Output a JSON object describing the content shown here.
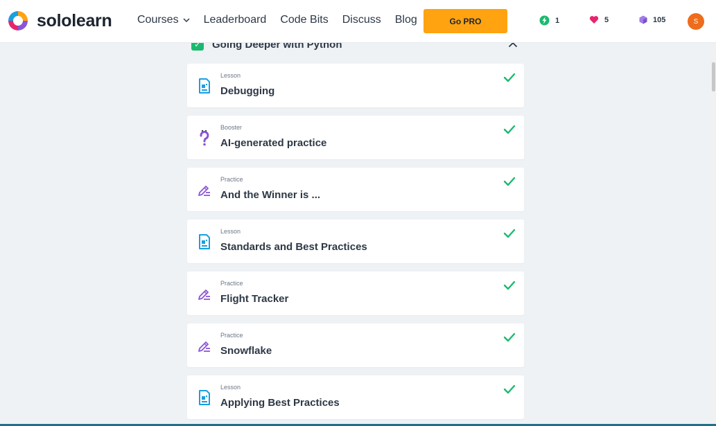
{
  "brand": {
    "name": "sololearn"
  },
  "nav": {
    "items": [
      {
        "label": "Courses",
        "has_dropdown": true
      },
      {
        "label": "Leaderboard"
      },
      {
        "label": "Code Bits"
      },
      {
        "label": "Discuss"
      },
      {
        "label": "Blog"
      }
    ],
    "go_pro_label": "Go PRO"
  },
  "stats": {
    "streak": "1",
    "hearts": "5",
    "bits": "105"
  },
  "user": {
    "avatar_initial": "S"
  },
  "module": {
    "title": "Going Deeper with Python",
    "completed": true
  },
  "lessons": [
    {
      "type": "Lesson",
      "title": "Debugging",
      "icon": "lesson-doc-icon",
      "done": true
    },
    {
      "type": "Booster",
      "title": "AI-generated practice",
      "icon": "question-icon",
      "done": true
    },
    {
      "type": "Practice",
      "title": "And the Winner is ...",
      "icon": "pencil-icon",
      "done": true
    },
    {
      "type": "Lesson",
      "title": "Standards and Best Practices",
      "icon": "lesson-doc-icon",
      "done": true
    },
    {
      "type": "Practice",
      "title": "Flight Tracker",
      "icon": "pencil-icon",
      "done": true
    },
    {
      "type": "Practice",
      "title": "Snowflake",
      "icon": "pencil-icon",
      "done": true
    },
    {
      "type": "Lesson",
      "title": "Applying Best Practices",
      "icon": "lesson-doc-icon",
      "done": true
    }
  ],
  "colors": {
    "accent_orange": "#ffa310",
    "check_green": "#1bb96f",
    "lesson_blue": "#1a9fe0",
    "practice_purple": "#8a55d6",
    "heart_pink": "#e8246d"
  }
}
